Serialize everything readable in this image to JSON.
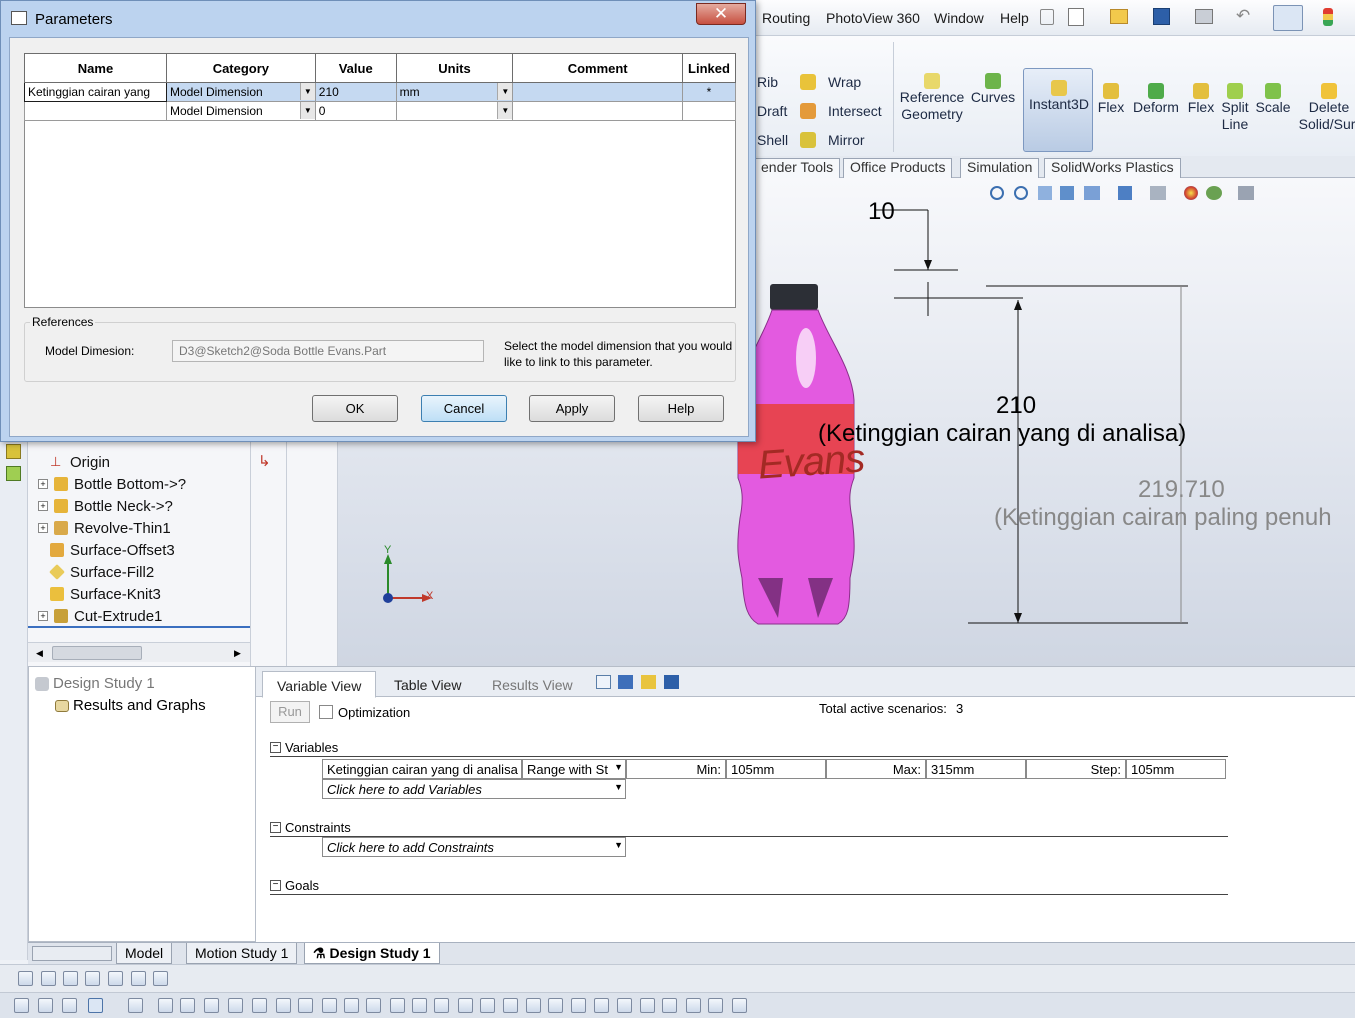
{
  "menu": {
    "items": [
      "Routing",
      "PhotoView 360",
      "Window",
      "Help"
    ]
  },
  "ribbon": {
    "rib": "Rib",
    "draft": "Draft",
    "shell": "Shell",
    "wrap": "Wrap",
    "intersect": "Intersect",
    "mirror": "Mirror",
    "reference_geometry": "Reference Geometry",
    "curves": "Curves",
    "instant3d": "Instant3D",
    "flex1": "Flex",
    "deform": "Deform",
    "flex2": "Flex",
    "split_line": "Split Line",
    "scale": "Scale",
    "delete_solid": "Delete Solid/Surf"
  },
  "cm_tabs": [
    "ender Tools",
    "Office Products",
    "Simulation",
    "SolidWorks Plastics"
  ],
  "dialog": {
    "title": "Parameters",
    "columns": [
      "Name",
      "Category",
      "Value",
      "Units",
      "Comment",
      "Linked"
    ],
    "rows": [
      {
        "name": "Ketinggian cairan yang",
        "category": "Model Dimension",
        "value": "210",
        "units": "mm",
        "comment": "",
        "linked": "*"
      },
      {
        "name": "",
        "category": "Model Dimension",
        "value": "0",
        "units": "",
        "comment": "",
        "linked": ""
      }
    ],
    "references_label": "References",
    "model_dimension_label": "Model Dimesion:",
    "model_dimension_value": "D3@Sketch2@Soda Bottle Evans.Part",
    "hint": "Select the model dimension that you would like to link to this parameter.",
    "ok": "OK",
    "cancel": "Cancel",
    "apply": "Apply",
    "help": "Help"
  },
  "tree": {
    "items": [
      {
        "label": "Origin",
        "expandable": false
      },
      {
        "label": "Bottle Bottom->?",
        "expandable": true
      },
      {
        "label": "Bottle Neck->?",
        "expandable": true
      },
      {
        "label": "Revolve-Thin1",
        "expandable": true
      },
      {
        "label": "Surface-Offset3",
        "expandable": false
      },
      {
        "label": "Surface-Fill2",
        "expandable": false
      },
      {
        "label": "Surface-Knit3",
        "expandable": false
      },
      {
        "label": "Cut-Extrude1",
        "expandable": true
      }
    ]
  },
  "viewport": {
    "dim_small": "10",
    "dim_main_value": "210",
    "dim_main_label": "(Ketinggian cairan yang di analisa)",
    "dim_ref_value": "219.710",
    "dim_ref_label": "(Ketinggian cairan paling penuh",
    "bottle_text": "Evans",
    "axis_x": "X",
    "axis_y": "Y"
  },
  "design_study": {
    "tree_root": "Design Study 1",
    "tree_child": "Results and Graphs",
    "tabs": [
      "Variable View",
      "Table View",
      "Results View"
    ],
    "run": "Run",
    "optimization": "Optimization",
    "scenarios_label": "Total active scenarios:",
    "scenarios_value": "3",
    "variables_header": "Variables",
    "variable_name": "Ketinggian cairan yang di analisa",
    "variable_type": "Range with St",
    "min_label": "Min:",
    "min_value": "105mm",
    "max_label": "Max:",
    "max_value": "315mm",
    "step_label": "Step:",
    "step_value": "105mm",
    "add_variables": "Click here to add Variables",
    "constraints_header": "Constraints",
    "add_constraints": "Click here to add Constraints",
    "goals_header": "Goals"
  },
  "bottom_tabs": [
    "Model",
    "Motion Study 1",
    "Design Study 1"
  ],
  "colors": {
    "accent": "#3c7fb1",
    "bottle_pink": "#e35ae0",
    "label_red": "#e8413a"
  }
}
